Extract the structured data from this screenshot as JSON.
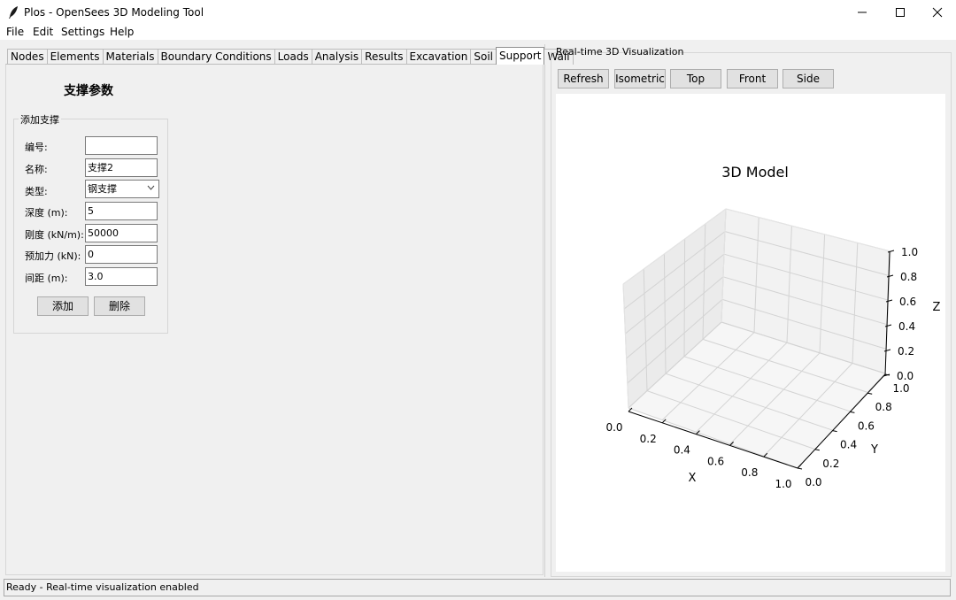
{
  "window": {
    "title": "Plos - OpenSees 3D Modeling Tool"
  },
  "menu": [
    "File",
    "Edit",
    "Settings",
    "Help"
  ],
  "tabs": [
    "Nodes",
    "Elements",
    "Materials",
    "Boundary Conditions",
    "Loads",
    "Analysis",
    "Results",
    "Excavation",
    "Soil",
    "Support",
    "Wall"
  ],
  "selected_tab": "Support",
  "support": {
    "heading": "支撑参数",
    "group_label": "添加支撑",
    "fields": {
      "id": {
        "label": "编号:",
        "value": ""
      },
      "name": {
        "label": "名称:",
        "value": "支撑2"
      },
      "type": {
        "label": "类型:",
        "value": "钢支撑"
      },
      "depth": {
        "label": "深度 (m):",
        "value": "5"
      },
      "stiffness": {
        "label": "刚度 (kN/m):",
        "value": "50000"
      },
      "prestress": {
        "label": "预加力 (kN):",
        "value": "0"
      },
      "spacing": {
        "label": "间距 (m):",
        "value": "3.0"
      }
    },
    "add_label": "添加",
    "delete_label": "删除"
  },
  "viz": {
    "panel_label": "Real-time 3D Visualization",
    "buttons": {
      "refresh": "Refresh",
      "isometric": "Isometric",
      "top": "Top",
      "front": "Front",
      "side": "Side"
    },
    "plot_title": "3D Model",
    "x_label": "X",
    "y_label": "Y",
    "z_label": "Z",
    "x_ticks": [
      "0.0",
      "0.2",
      "0.4",
      "0.6",
      "0.8",
      "1.0"
    ],
    "y_ticks": [
      "0.0",
      "0.2",
      "0.4",
      "0.6",
      "0.8",
      "1.0"
    ],
    "z_ticks": [
      "0.0",
      "0.2",
      "0.4",
      "0.6",
      "0.8",
      "1.0"
    ]
  },
  "status": "Ready - Real-time visualization enabled"
}
